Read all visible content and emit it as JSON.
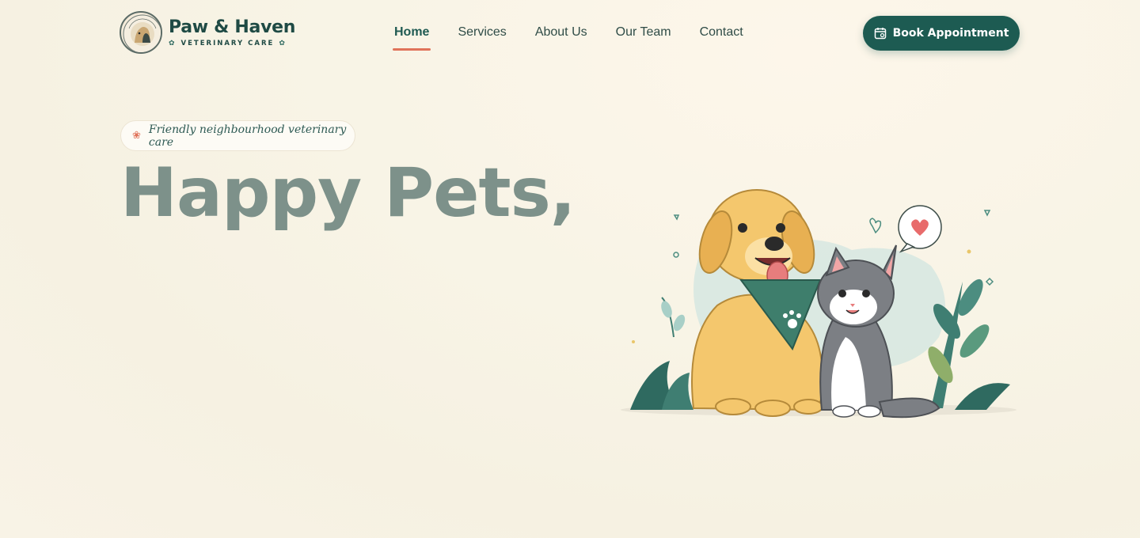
{
  "header": {
    "brand_name": "Paw & Haven",
    "brand_sub": "VETERINARY CARE",
    "logo_ring_text": "PAW & HAVEN · VETERINARY CARE"
  },
  "nav": {
    "items": [
      {
        "label": "Home",
        "active": true
      },
      {
        "label": "Services",
        "active": false
      },
      {
        "label": "About Us",
        "active": false
      },
      {
        "label": "Our Team",
        "active": false
      },
      {
        "label": "Contact",
        "active": false
      }
    ]
  },
  "cta": {
    "label": "Book Appointment",
    "icon": "calendar-icon"
  },
  "hero": {
    "tagline": "Friendly neighbourhood veterinary care",
    "tagline_icon": "paw-icon",
    "title": "Happy Pets,"
  },
  "colors": {
    "brand": "#1d5b52",
    "accent": "#e0735a",
    "title": "#7d918a",
    "background": "#f8f4e6"
  }
}
